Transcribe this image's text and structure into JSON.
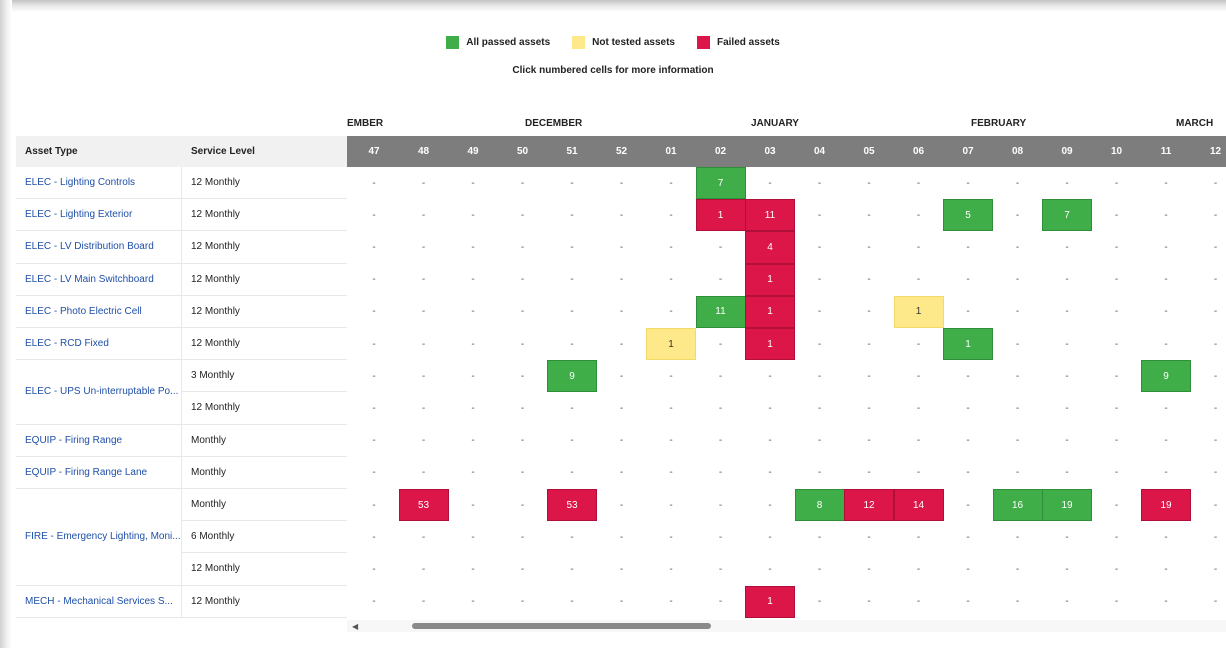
{
  "legend": {
    "items": [
      {
        "label": "All passed assets",
        "color": "#3fae49"
      },
      {
        "label": "Not tested assets",
        "color": "#fde98a"
      },
      {
        "label": "Failed assets",
        "color": "#dc1649"
      }
    ],
    "hint": "Click numbered cells for more information"
  },
  "months": [
    "EMBER",
    "DECEMBER",
    "JANUARY",
    "FEBRUARY",
    "MARCH"
  ],
  "headers": {
    "asset_type": "Asset Type",
    "service_level": "Service Level"
  },
  "weeks": [
    "47",
    "48",
    "49",
    "50",
    "51",
    "52",
    "01",
    "02",
    "03",
    "04",
    "05",
    "06",
    "07",
    "08",
    "09",
    "10",
    "11",
    "12"
  ],
  "empty_marker": "-",
  "rows": [
    {
      "asset": "ELEC - Lighting Controls",
      "service": "12 Monthly",
      "cells": {
        "02": [
          "pass",
          7
        ]
      }
    },
    {
      "asset": "ELEC - Lighting Exterior",
      "service": "12 Monthly",
      "cells": {
        "02": [
          "fail",
          1
        ],
        "03": [
          "fail",
          11
        ],
        "07": [
          "pass",
          5
        ],
        "09": [
          "pass",
          7
        ]
      }
    },
    {
      "asset": "ELEC - LV Distribution Board",
      "service": "12 Monthly",
      "cells": {
        "03": [
          "fail",
          4
        ]
      }
    },
    {
      "asset": "ELEC - LV Main Switchboard",
      "service": "12 Monthly",
      "cells": {
        "03": [
          "fail",
          1
        ]
      }
    },
    {
      "asset": "ELEC - Photo Electric Cell",
      "service": "12 Monthly",
      "cells": {
        "02": [
          "pass",
          11
        ],
        "03": [
          "fail",
          1
        ],
        "06": [
          "nt",
          1
        ]
      }
    },
    {
      "asset": "ELEC - RCD Fixed",
      "service": "12 Monthly",
      "cells": {
        "01": [
          "nt",
          1
        ],
        "03": [
          "fail",
          1
        ],
        "07": [
          "pass",
          1
        ]
      }
    },
    {
      "asset": "ELEC - UPS Un-interruptable Po...",
      "service": "3 Monthly",
      "cells": {
        "51": [
          "pass",
          9
        ],
        "11": [
          "pass",
          9
        ]
      }
    },
    {
      "asset": "",
      "service": "12 Monthly",
      "cells": {}
    },
    {
      "asset": "EQUIP - Firing Range",
      "service": "Monthly",
      "cells": {}
    },
    {
      "asset": "EQUIP - Firing Range Lane",
      "service": "Monthly",
      "cells": {}
    },
    {
      "asset": "FIRE - Emergency Lighting, Moni...",
      "service": "Monthly",
      "cells": {
        "48": [
          "fail",
          53
        ],
        "51": [
          "fail",
          53
        ],
        "04": [
          "pass",
          8
        ],
        "05": [
          "fail",
          12
        ],
        "06": [
          "fail",
          14
        ],
        "08": [
          "pass",
          16
        ],
        "09": [
          "pass",
          19
        ],
        "11": [
          "fail",
          19
        ]
      }
    },
    {
      "asset": "",
      "service": "6 Monthly",
      "cells": {}
    },
    {
      "asset": "",
      "service": "12 Monthly",
      "cells": {}
    },
    {
      "asset": "MECH - Mechanical Services S...",
      "service": "12 Monthly",
      "cells": {
        "03": [
          "fail",
          1
        ]
      }
    }
  ]
}
